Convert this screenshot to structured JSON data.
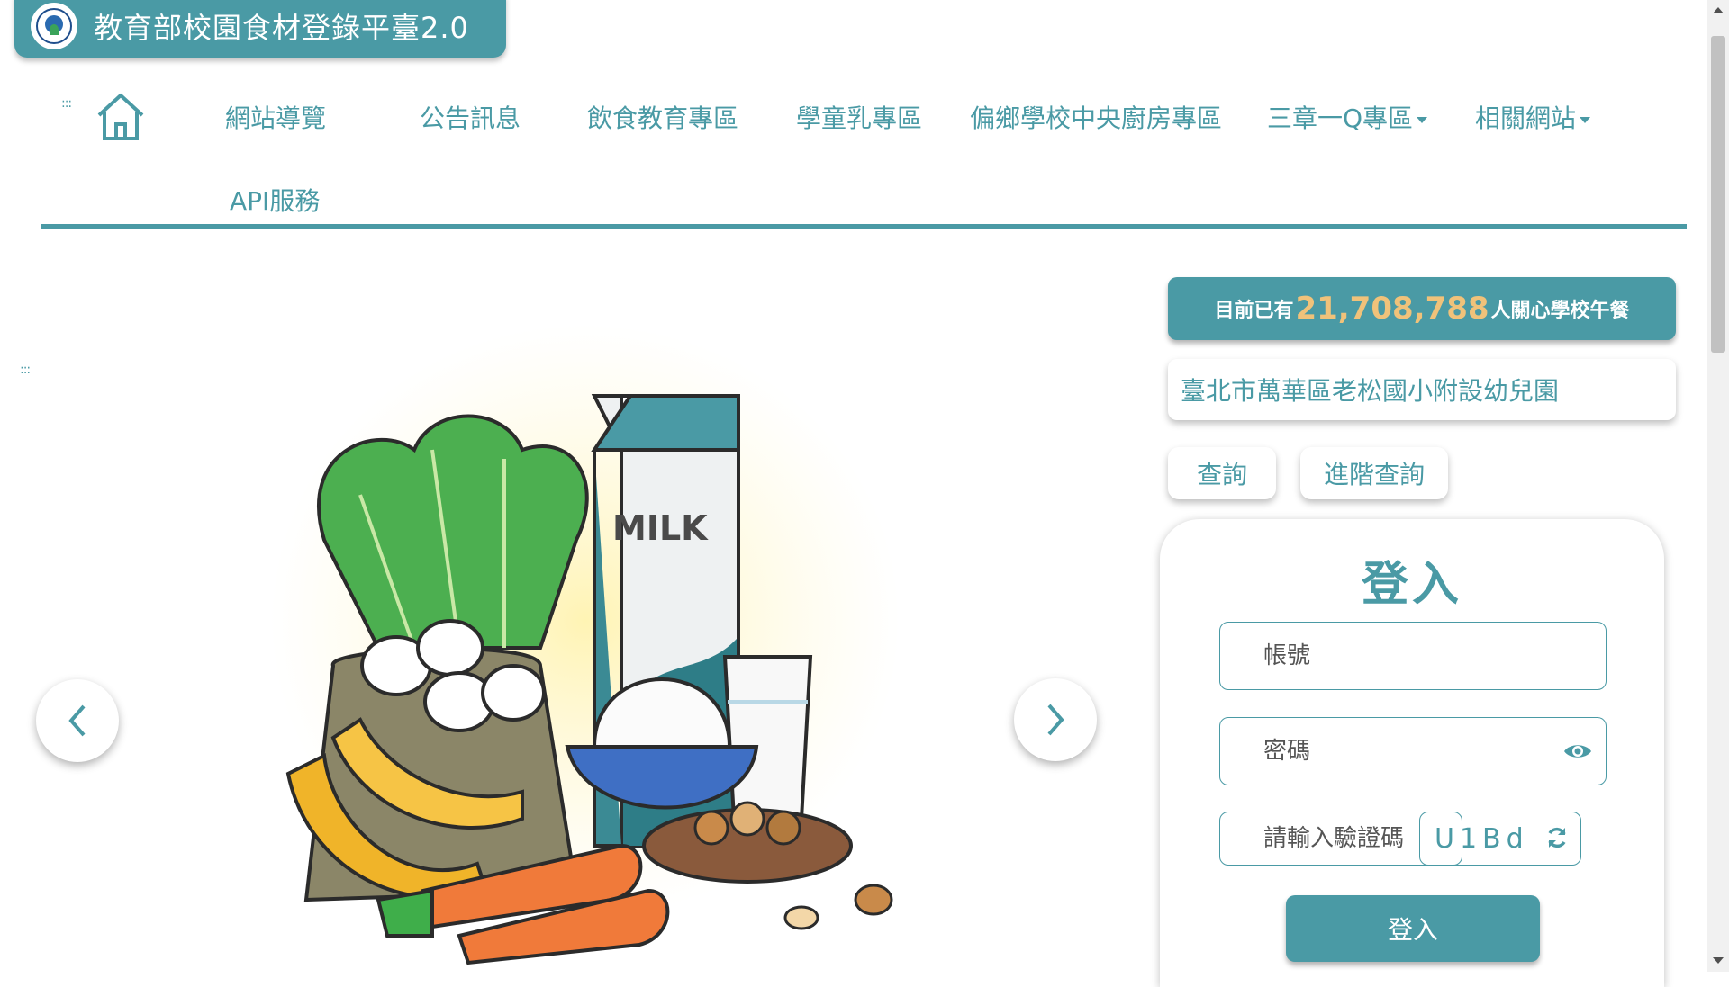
{
  "site": {
    "title": "教育部校園食材登錄平臺2.0"
  },
  "nav": {
    "items": [
      {
        "label": "網站導覽"
      },
      {
        "label": "公告訊息"
      },
      {
        "label": "飲食教育專區"
      },
      {
        "label": "學童乳專區"
      },
      {
        "label": "偏鄉學校中央廚房專區"
      },
      {
        "label": "三章一Q專區"
      },
      {
        "label": "相關網站"
      },
      {
        "label": "API服務"
      }
    ],
    "grip": ":::"
  },
  "carousel": {
    "grip": ":::",
    "milk_label": "MILK",
    "icons": [
      "chevron-left-icon",
      "chevron-right-icon"
    ]
  },
  "stats": {
    "prefix": "目前已有",
    "count": "21,708,788",
    "suffix": "人關心學校午餐"
  },
  "search": {
    "school_value": "臺北市萬華區老松國小附設幼兒園",
    "query_button": "查詢",
    "advanced_button": "進階查詢"
  },
  "login": {
    "title": "登入",
    "account_placeholder": "帳號",
    "password_placeholder": "密碼",
    "captcha_placeholder": "請輸入驗證碼",
    "captcha_code": "U1Bd",
    "submit_label": "登入"
  },
  "colors": {
    "accent": "#4a9aa5",
    "counter_number": "#f0c27a"
  }
}
